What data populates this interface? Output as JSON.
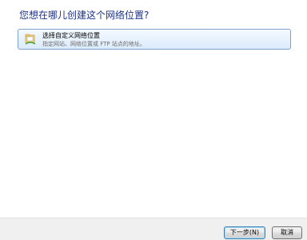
{
  "wizard": {
    "question": "您想在哪儿创建这个网络位置?",
    "option": {
      "icon": "folder-network-icon",
      "title": "选择自定义网络位置",
      "description": "指定网站、网络位置或 FTP 站点的地址。"
    }
  },
  "buttons": {
    "next_label": "下一步(N)",
    "cancel_label": "取消"
  },
  "colors": {
    "heading": "#1e3287",
    "selection_border": "#7da2ce",
    "selection_fill": "#dcebfc",
    "footer_bg": "#f0f0f0"
  }
}
